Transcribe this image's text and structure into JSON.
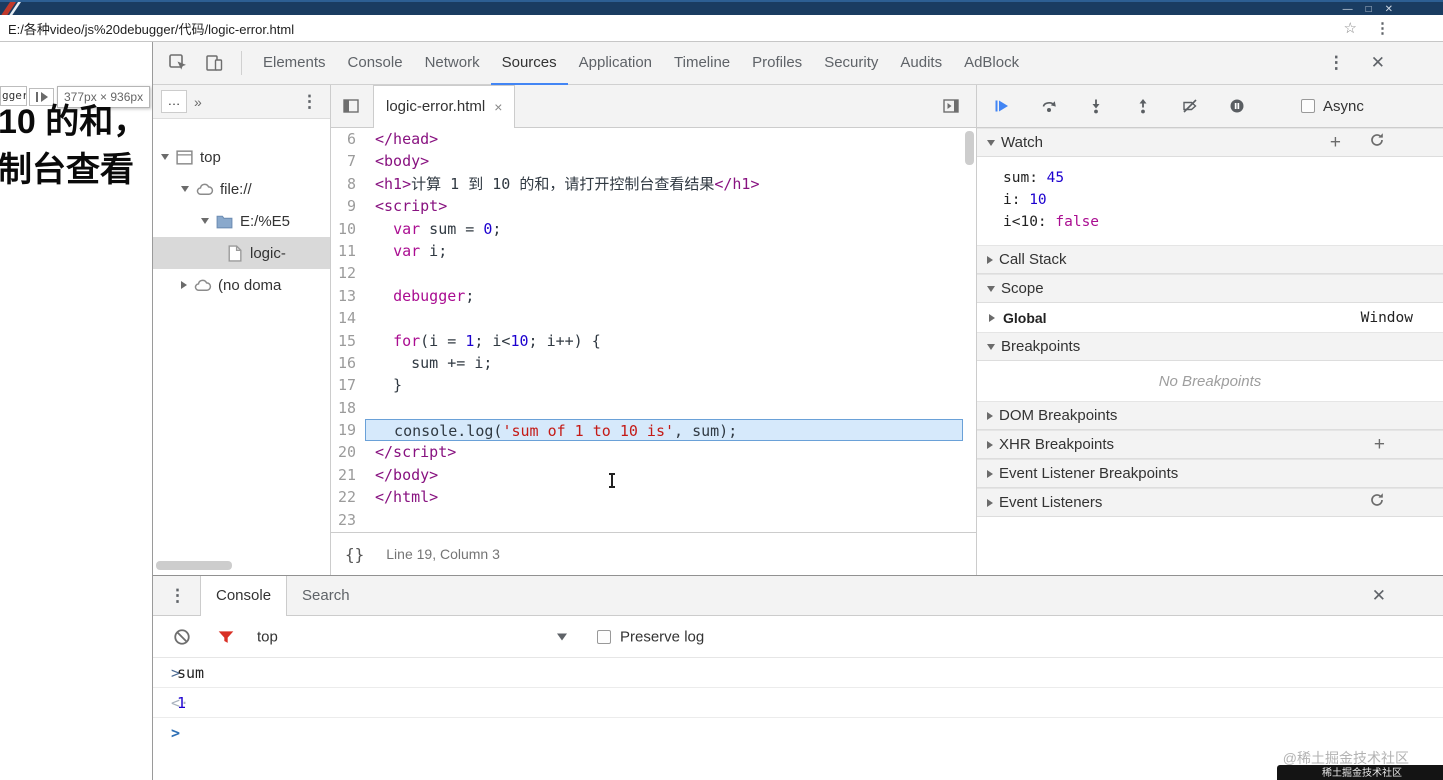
{
  "titlebar": {
    "minimize": "—",
    "maximize": "□",
    "close": "✕"
  },
  "address_bar": {
    "url": "E:/各种video/js%20debugger/代码/logic-error.html",
    "star_icon": "☆",
    "menu_icon": "⋮"
  },
  "page": {
    "heading_line1": "10 的和，",
    "heading_line2": "制台查看",
    "tab_fragment": "gger",
    "dimension_tooltip": "377px × 936px"
  },
  "devtools": {
    "tabs": [
      "Elements",
      "Console",
      "Network",
      "Sources",
      "Application",
      "Timeline",
      "Profiles",
      "Security",
      "Audits",
      "AdBlock"
    ],
    "active_tab": "Sources",
    "more_icon": "⋮",
    "close_icon": "✕",
    "navigator": {
      "overflow_tab": "…",
      "chevron": "»",
      "menu_icon": "⋮",
      "items": [
        {
          "label": "top"
        },
        {
          "label": "file://"
        },
        {
          "label": "E:/%E5"
        },
        {
          "label": "logic-"
        },
        {
          "label": "(no doma"
        }
      ]
    },
    "editor": {
      "tab_label": "logic-error.html",
      "tab_close": "×",
      "status_braces": "{}",
      "status_text": "Line 19, Column 3",
      "lines": [
        {
          "n": 6,
          "tokens": [
            {
              "t": "tag",
              "s": "</head>"
            }
          ]
        },
        {
          "n": 7,
          "tokens": [
            {
              "t": "tag",
              "s": "<body>"
            }
          ]
        },
        {
          "n": 8,
          "tokens": [
            {
              "t": "tag",
              "s": "<h1>"
            },
            {
              "t": "plain",
              "s": "计算 1 到 10 的和，请打开控制台查看结果"
            },
            {
              "t": "tag",
              "s": "</h1>"
            }
          ]
        },
        {
          "n": 9,
          "tokens": [
            {
              "t": "tag",
              "s": "<script>"
            }
          ]
        },
        {
          "n": 10,
          "tokens": [
            {
              "t": "plain",
              "s": "  "
            },
            {
              "t": "kw",
              "s": "var"
            },
            {
              "t": "plain",
              "s": " sum = "
            },
            {
              "t": "num",
              "s": "0"
            },
            {
              "t": "plain",
              "s": ";"
            }
          ]
        },
        {
          "n": 11,
          "tokens": [
            {
              "t": "plain",
              "s": "  "
            },
            {
              "t": "kw",
              "s": "var"
            },
            {
              "t": "plain",
              "s": " i;"
            }
          ]
        },
        {
          "n": 12,
          "tokens": []
        },
        {
          "n": 13,
          "tokens": [
            {
              "t": "plain",
              "s": "  "
            },
            {
              "t": "kw",
              "s": "debugger"
            },
            {
              "t": "plain",
              "s": ";"
            }
          ]
        },
        {
          "n": 14,
          "tokens": []
        },
        {
          "n": 15,
          "tokens": [
            {
              "t": "plain",
              "s": "  "
            },
            {
              "t": "kw",
              "s": "for"
            },
            {
              "t": "plain",
              "s": "(i = "
            },
            {
              "t": "num",
              "s": "1"
            },
            {
              "t": "plain",
              "s": "; i<"
            },
            {
              "t": "num",
              "s": "10"
            },
            {
              "t": "plain",
              "s": "; i++) {"
            }
          ]
        },
        {
          "n": 16,
          "tokens": [
            {
              "t": "plain",
              "s": "    sum += i;"
            }
          ]
        },
        {
          "n": 17,
          "tokens": [
            {
              "t": "plain",
              "s": "  }"
            }
          ]
        },
        {
          "n": 18,
          "tokens": []
        },
        {
          "n": 19,
          "hl": true,
          "tokens": [
            {
              "t": "plain",
              "s": "  console.log("
            },
            {
              "t": "str",
              "s": "'sum of 1 to 10 is'"
            },
            {
              "t": "plain",
              "s": ", sum);"
            }
          ]
        },
        {
          "n": 20,
          "tokens": [
            {
              "t": "tag",
              "s": "</script>"
            }
          ]
        },
        {
          "n": 21,
          "tokens": [
            {
              "t": "tag",
              "s": "</body>"
            }
          ]
        },
        {
          "n": 22,
          "tokens": [
            {
              "t": "tag",
              "s": "</html>"
            }
          ]
        },
        {
          "n": 23,
          "tokens": []
        }
      ]
    },
    "debugger": {
      "async_label": "Async",
      "watch": {
        "title": "Watch",
        "items": [
          {
            "name": "sum",
            "value": "45"
          },
          {
            "name": "i",
            "value": "10"
          },
          {
            "name": "i<10",
            "value": "false"
          }
        ]
      },
      "call_stack_title": "Call Stack",
      "scope_title": "Scope",
      "scope_global": {
        "name": "Global",
        "value": "Window"
      },
      "breakpoints_title": "Breakpoints",
      "no_breakpoints": "No Breakpoints",
      "dom_breakpoints_title": "DOM Breakpoints",
      "xhr_breakpoints_title": "XHR Breakpoints",
      "event_listener_breakpoints_title": "Event Listener Breakpoints",
      "event_listeners_title": "Event Listeners",
      "add_icon": "+"
    },
    "console": {
      "menu_icon": "⋮",
      "tab_console": "Console",
      "tab_search": "Search",
      "close_icon": "✕",
      "context": "top",
      "preserve_log": "Preserve log",
      "entries": [
        {
          "kind": "input",
          "symbol": ">",
          "text": "sum"
        },
        {
          "kind": "result",
          "symbol": "<·",
          "text": "1"
        },
        {
          "kind": "prompt",
          "symbol": ">",
          "text": ""
        }
      ]
    }
  },
  "watermark": {
    "text": "@稀土掘金技术社区",
    "badge": "稀土掘金技术社区"
  }
}
